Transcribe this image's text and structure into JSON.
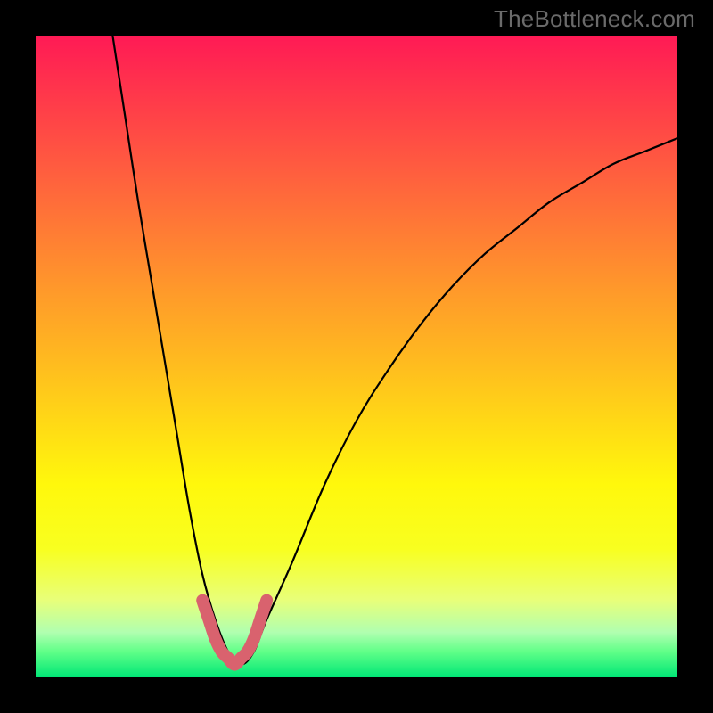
{
  "watermark": "TheBottleneck.com",
  "chart_data": {
    "type": "line",
    "title": "",
    "xlabel": "",
    "ylabel": "",
    "xlim": [
      0,
      100
    ],
    "ylim": [
      0,
      100
    ],
    "series": [
      {
        "name": "bottleneck-curve",
        "x": [
          12,
          14,
          16,
          18,
          20,
          22,
          24,
          26,
          28,
          30,
          32,
          34,
          36,
          40,
          45,
          50,
          55,
          60,
          65,
          70,
          75,
          80,
          85,
          90,
          95,
          100
        ],
        "values": [
          100,
          87,
          74,
          62,
          50,
          38,
          26,
          16,
          9,
          4,
          2,
          4,
          9,
          18,
          30,
          40,
          48,
          55,
          61,
          66,
          70,
          74,
          77,
          80,
          82,
          84
        ]
      }
    ],
    "highlight": {
      "x": [
        26,
        28,
        30,
        32,
        34
      ],
      "values": [
        16,
        9,
        4,
        2,
        4,
        9,
        16
      ],
      "color": "#d9626e"
    }
  }
}
